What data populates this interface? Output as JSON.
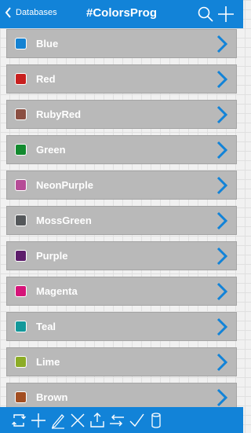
{
  "header": {
    "back_label": "Databases",
    "title": "#ColorsProg",
    "accent_color": "#1283d8"
  },
  "colors": [
    {
      "label": "Blue",
      "swatch": "#1482d2"
    },
    {
      "label": "Red",
      "swatch": "#c8201f"
    },
    {
      "label": "RubyRed",
      "swatch": "#8b4f42"
    },
    {
      "label": "Green",
      "swatch": "#138a2f"
    },
    {
      "label": "NeonPurple",
      "swatch": "#b64c97"
    },
    {
      "label": "MossGreen",
      "swatch": "#55585b"
    },
    {
      "label": "Purple",
      "swatch": "#5c1c6a"
    },
    {
      "label": "Magenta",
      "swatch": "#d51479"
    },
    {
      "label": "Teal",
      "swatch": "#13989a"
    },
    {
      "label": "Lime",
      "swatch": "#8cac26"
    },
    {
      "label": "Brown",
      "swatch": "#a24e22"
    }
  ],
  "toolbar": {
    "icons": [
      "sync-icon",
      "plus-icon",
      "pencil-icon",
      "delete-icon",
      "upload-icon",
      "sort-icon",
      "check-icon",
      "database-icon"
    ]
  }
}
